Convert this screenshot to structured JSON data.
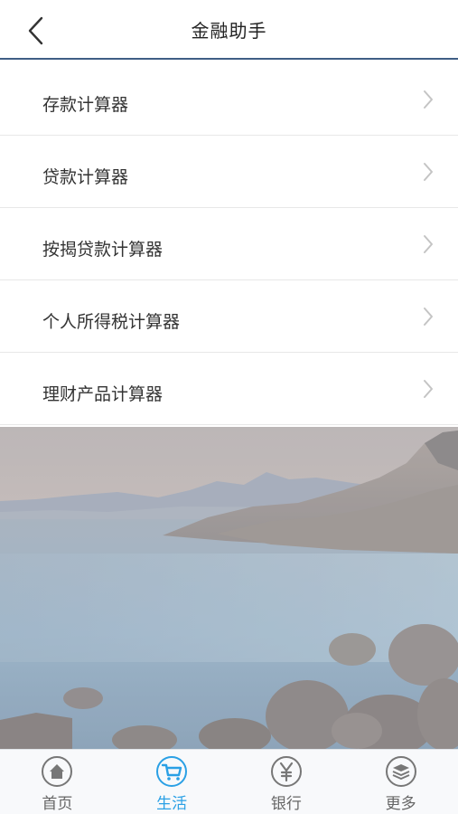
{
  "header": {
    "title": "金融助手",
    "back_icon": "chevron-left-icon",
    "accent": "#3f5e85"
  },
  "menu": {
    "items": [
      {
        "label": "存款计算器"
      },
      {
        "label": "贷款计算器"
      },
      {
        "label": "按揭贷款计算器"
      },
      {
        "label": "个人所得税计算器"
      },
      {
        "label": "理财产品计算器"
      }
    ]
  },
  "tabbar": {
    "active_color": "#2aa0e5",
    "tabs": [
      {
        "label": "首页",
        "icon": "home-icon",
        "active": false
      },
      {
        "label": "生活",
        "icon": "cart-icon",
        "active": true
      },
      {
        "label": "银行",
        "icon": "yuan-icon",
        "active": false
      },
      {
        "label": "更多",
        "icon": "layers-icon",
        "active": false
      }
    ]
  }
}
